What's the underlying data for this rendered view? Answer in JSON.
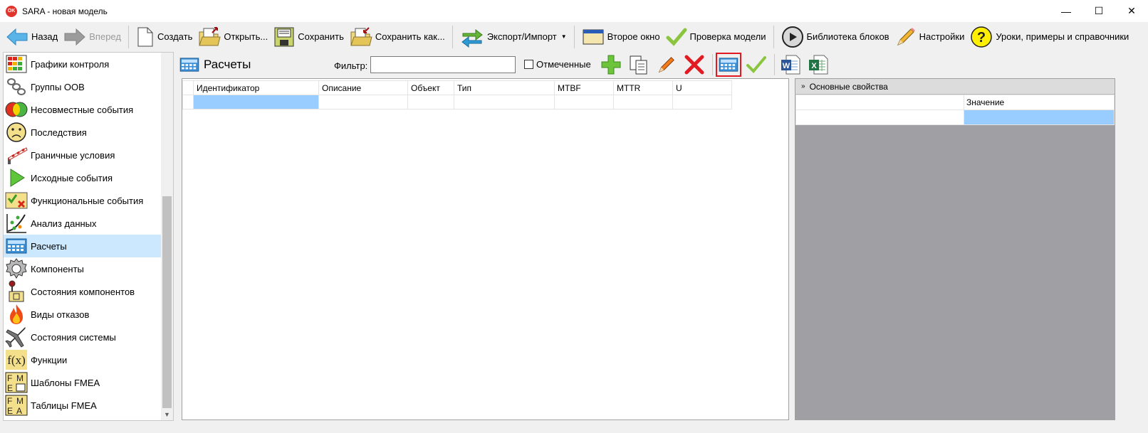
{
  "window": {
    "title": "SARA - новая модель",
    "app_icon_text": "OK",
    "minimize": "—",
    "maximize": "☐",
    "close": "✕"
  },
  "toolbar": {
    "back": "Назад",
    "forward": "Вперед",
    "create": "Создать",
    "open": "Открыть...",
    "save": "Сохранить",
    "save_as": "Сохранить как...",
    "export_import": "Экспорт/Импорт",
    "second_window": "Второе окно",
    "check_model": "Проверка модели",
    "block_library": "Библиотека блоков",
    "settings": "Настройки",
    "help": "Уроки, примеры и справочники"
  },
  "sidebar": {
    "items": [
      {
        "label": "Графики контроля",
        "icon": "control-chart-icon"
      },
      {
        "label": "Группы ООВ",
        "icon": "chain-links-icon"
      },
      {
        "label": "Несовместные события",
        "icon": "venn-icon"
      },
      {
        "label": "Последствия",
        "icon": "sad-face-icon"
      },
      {
        "label": "Граничные условия",
        "icon": "barrier-icon"
      },
      {
        "label": "Исходные события",
        "icon": "play-triangle-icon"
      },
      {
        "label": "Функциональные события",
        "icon": "check-cross-icon"
      },
      {
        "label": "Анализ данных",
        "icon": "data-analysis-icon"
      },
      {
        "label": "Расчеты",
        "icon": "calculator-icon",
        "selected": true
      },
      {
        "label": "Компоненты",
        "icon": "gear-icon"
      },
      {
        "label": "Состояния компонентов",
        "icon": "lever-icon"
      },
      {
        "label": "Виды отказов",
        "icon": "flame-icon"
      },
      {
        "label": "Состояния системы",
        "icon": "plane-icon"
      },
      {
        "label": "Функции",
        "icon": "function-icon"
      },
      {
        "label": "Шаблоны FMEA",
        "icon": "fmea-template-icon"
      },
      {
        "label": "Таблицы FMEA",
        "icon": "fmea-table-icon"
      }
    ]
  },
  "main": {
    "title": "Расчеты",
    "filter_label": "Фильтр:",
    "filter_value": "",
    "marked_label": "Отмеченные",
    "columns": [
      "Идентификатор",
      "Описание",
      "Объект",
      "Тип",
      "MTBF",
      "MTTR",
      "U"
    ]
  },
  "properties": {
    "header": "Основные свойства",
    "value_column": "Значение"
  },
  "colors": {
    "selection": "#cce8ff",
    "active_border": "#e21b23",
    "grid_selection": "#99ccff"
  }
}
